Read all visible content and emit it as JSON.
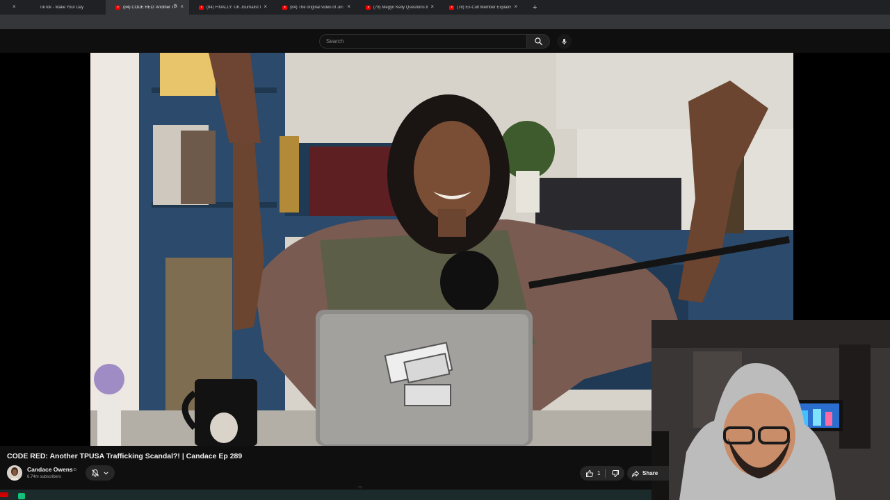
{
  "browser": {
    "tabs": [
      {
        "title": "TikTok - Make Your Day",
        "icon": "tiktok-icon"
      },
      {
        "title": "(84) CODE RED: Another TPUSA",
        "icon": "youtube-icon",
        "active": true,
        "audio": true
      },
      {
        "title": "(84) FINALLY: UK Journalist CON",
        "icon": "youtube-icon"
      },
      {
        "title": "(84) The original video of Jin sh",
        "icon": "youtube-icon"
      },
      {
        "title": "(78) Megyn Kelly Questions th",
        "icon": "youtube-icon"
      },
      {
        "title": "(78) Ex-Cult Member Explains h",
        "icon": "youtube-icon"
      }
    ],
    "new_tab_symbol": "+",
    "close_symbol": "×"
  },
  "masthead": {
    "search_placeholder": "Search",
    "icons": [
      "search-icon",
      "microphone-icon"
    ]
  },
  "video": {
    "title": "CODE RED: Another TPUSA Trafficking Scandal?! | Candace Ep 289",
    "channel": "Candace Owens",
    "verified_symbol": "⊙",
    "subscribers": "6.74m subscribers",
    "likes": "1",
    "share_label": "Share"
  },
  "colors": {
    "background": "#0f0f0f",
    "tab_strip": "#202124",
    "active_tab": "#35363a",
    "chip": "#272727",
    "youtube_red": "#ff0000"
  }
}
